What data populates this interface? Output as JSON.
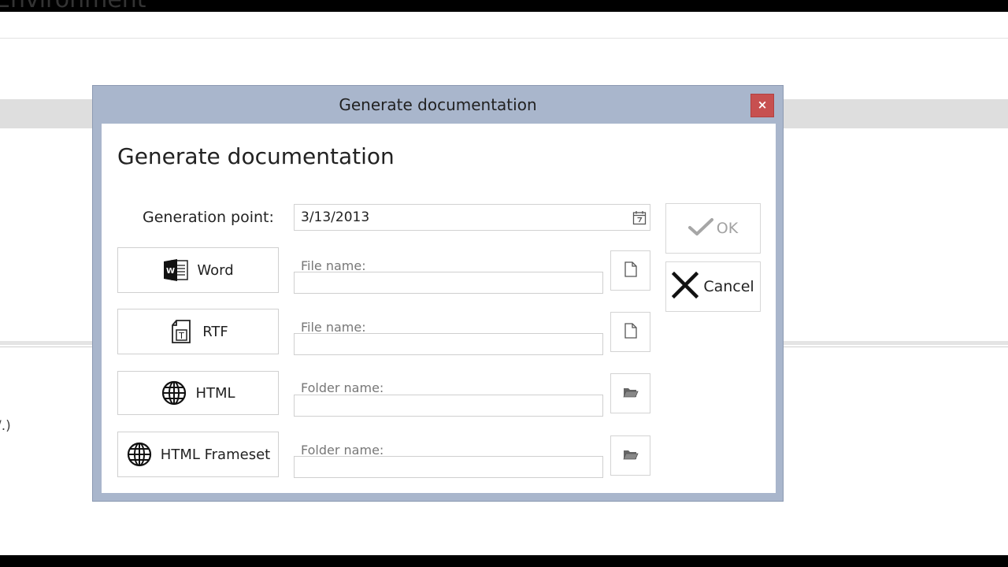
{
  "background": {
    "heading_fragment": "Environment",
    "text_fragment": "/.)"
  },
  "dialog": {
    "title": "Generate documentation",
    "close_label": "×",
    "heading": "Generate documentation",
    "generation_point": {
      "label": "Generation point:",
      "value": "3/13/2013",
      "icon": "calendar-icon"
    },
    "outputs": [
      {
        "label": "Word",
        "icon": "word-icon",
        "field_label": "File name:",
        "value": "",
        "browse_icon": "file-icon"
      },
      {
        "label": "RTF",
        "icon": "rtf-icon",
        "field_label": "File name:",
        "value": "",
        "browse_icon": "file-icon"
      },
      {
        "label": "HTML",
        "icon": "globe-icon",
        "field_label": "Folder name:",
        "value": "",
        "browse_icon": "folder-icon"
      },
      {
        "label": "HTML Frameset",
        "icon": "globe-icon",
        "field_label": "Folder name:",
        "value": "",
        "browse_icon": "folder-icon"
      }
    ],
    "ok_label": "OK",
    "ok_enabled": false,
    "cancel_label": "Cancel"
  },
  "colors": {
    "dialog_frame": "#a9b6cc",
    "close_button": "#c75050",
    "disabled_text": "#a2a2a2"
  }
}
